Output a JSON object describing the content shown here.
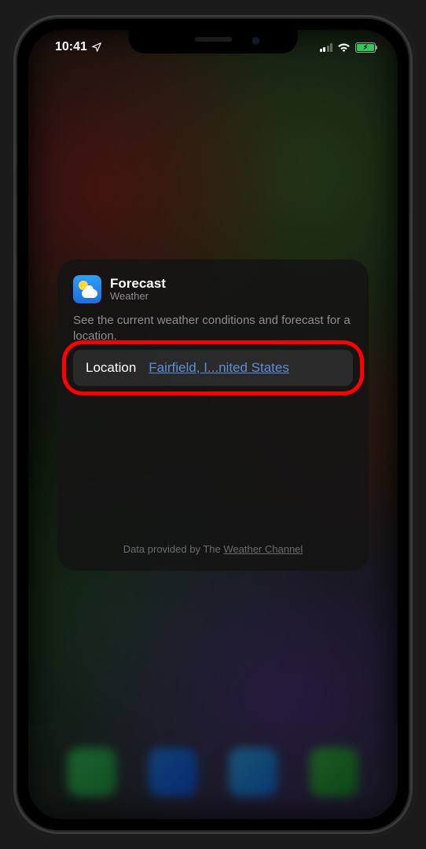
{
  "status_bar": {
    "time": "10:41",
    "location_arrow": "location-arrow-icon",
    "signal_icon": "cellular-signal-icon",
    "wifi_icon": "wifi-icon",
    "battery_icon": "battery-charging-icon"
  },
  "widget": {
    "app_icon": "weather-app-icon",
    "title": "Forecast",
    "subtitle": "Weather",
    "description": "See the current weather conditions and forecast for a location.",
    "location_row": {
      "label": "Location",
      "value": "Fairfield, I...nited States"
    },
    "provider_prefix": "Data provided by The ",
    "provider_link": "Weather Channel"
  }
}
